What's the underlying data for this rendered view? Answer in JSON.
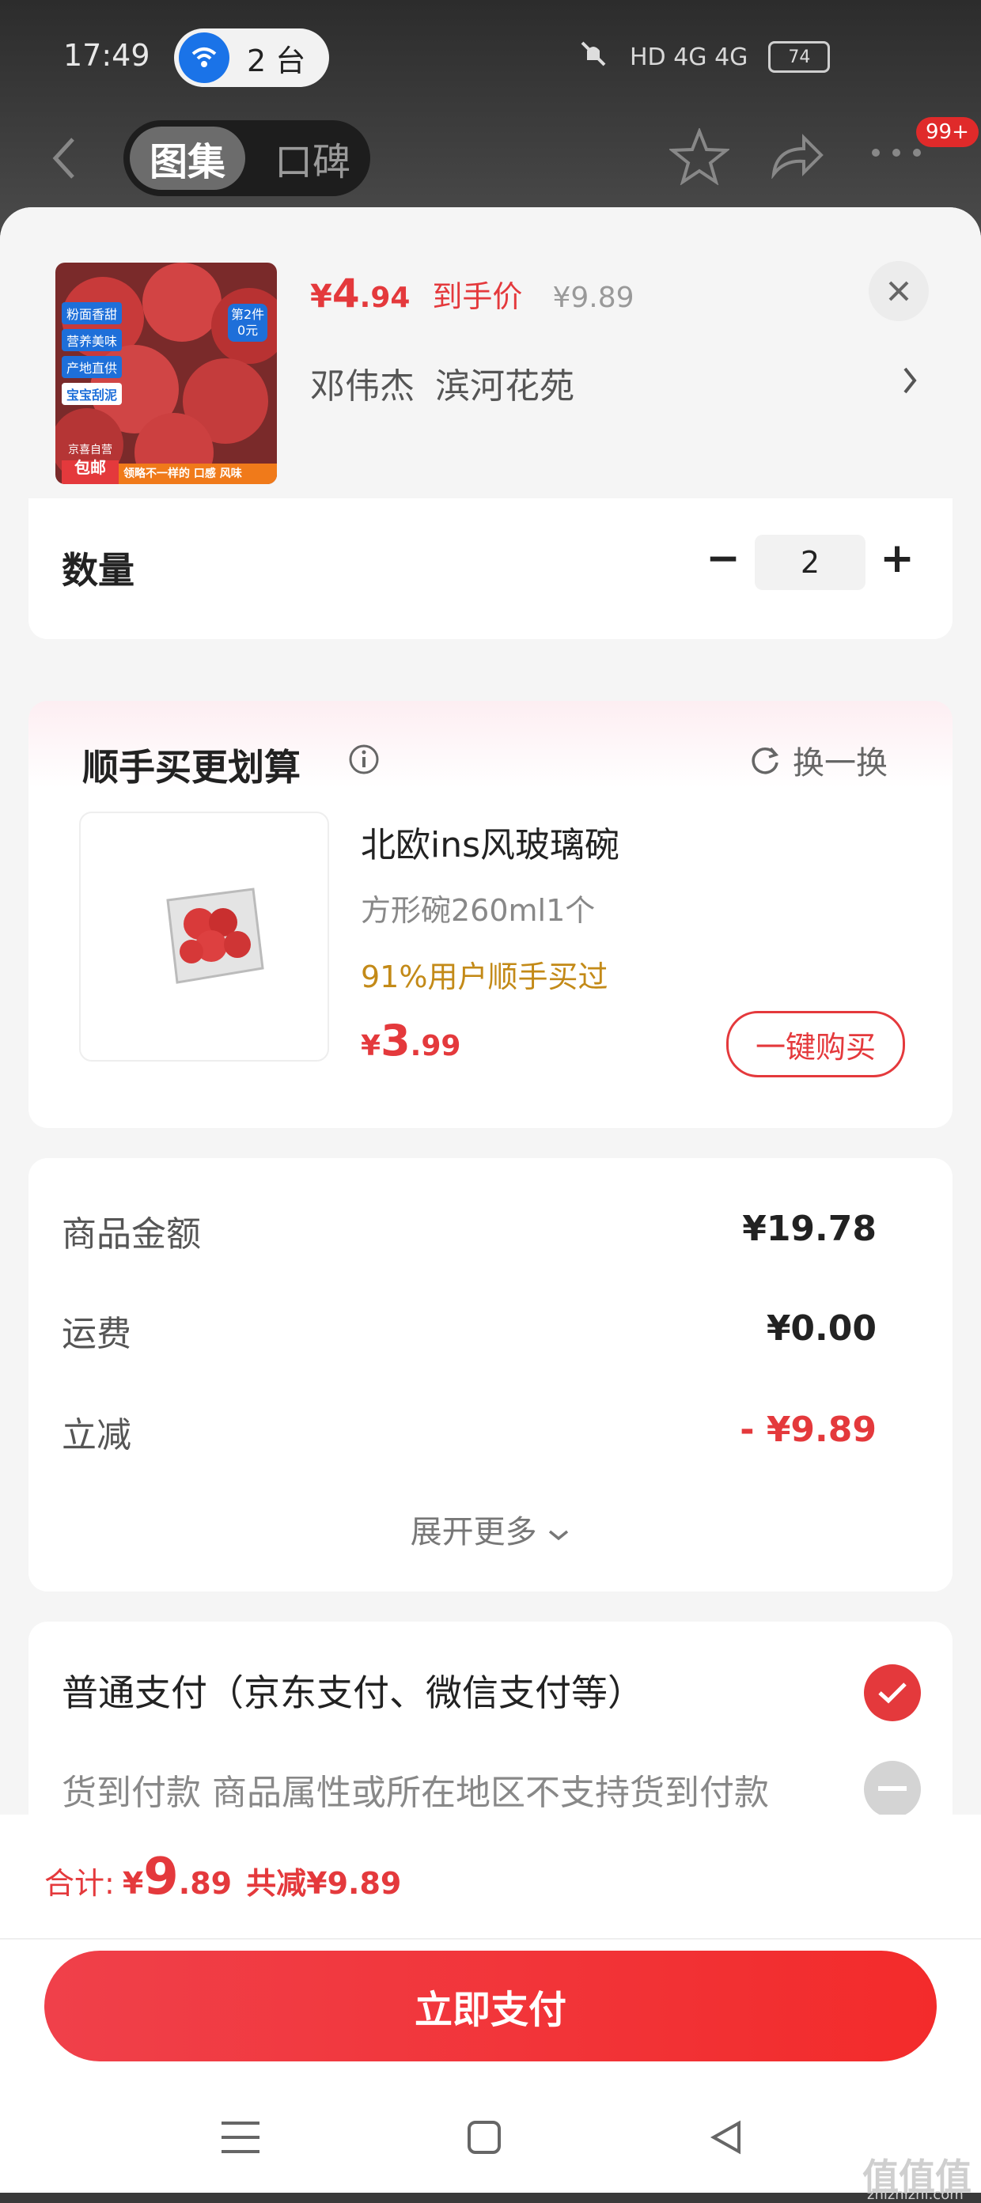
{
  "status_bar": {
    "time": "17:49",
    "hotspot": "2 台",
    "network": "HD 4G 4G",
    "battery": "74"
  },
  "top_nav": {
    "tab_active": "图集",
    "tab_inactive": "口碑",
    "badge": "99+"
  },
  "product": {
    "price_currency": "¥",
    "price_int": "4",
    "price_dec": ".94",
    "price_tag": "到手价",
    "original_price": "¥9.89",
    "address_name": "邓伟杰",
    "address_place": "滨河花苑",
    "thumb_badges": [
      "粉面香甜",
      "营养美味",
      "产地直供",
      "宝宝刮泥"
    ],
    "thumb_promo_top": "第2件",
    "thumb_promo_bottom": "0元",
    "thumb_left_tag_top": "京喜自营",
    "thumb_left_tag_bottom": "包邮",
    "thumb_bottom_banner": "领略不一样的 口感 风味"
  },
  "quantity": {
    "label": "数量",
    "value": "2",
    "minus": "−",
    "plus": "+"
  },
  "upsell": {
    "title": "顺手买更划算",
    "swap_label": "换一换",
    "item_name": "北欧ins风玻璃碗",
    "item_spec": "方形碗260ml1个",
    "item_social": "91%用户顺手买过",
    "item_price_currency": "¥",
    "item_price_int": "3",
    "item_price_dec": ".99",
    "buy_label": "一键购买"
  },
  "summary": {
    "rows": [
      {
        "label": "商品金额",
        "value": "¥19.78"
      },
      {
        "label": "运费",
        "value": "¥0.00"
      },
      {
        "label": "立减",
        "value": "- ¥9.89"
      }
    ],
    "expand_label": "展开更多"
  },
  "payment": {
    "option1": "普通支付（京东支付、微信支付等）",
    "option2": "货到付款 商品属性或所在地区不支持货到付款"
  },
  "footer": {
    "total_label": "合计:",
    "total_currency": "¥",
    "total_int": "9",
    "total_dec": ".89",
    "savings": "共减¥9.89",
    "pay_label": "立即支付"
  },
  "watermark": {
    "mark": "值值值",
    "site": "zhizhizhi.com"
  },
  "colors": {
    "accent": "#e4393c",
    "social": "#c38a18",
    "background": "#f5f5f5"
  }
}
